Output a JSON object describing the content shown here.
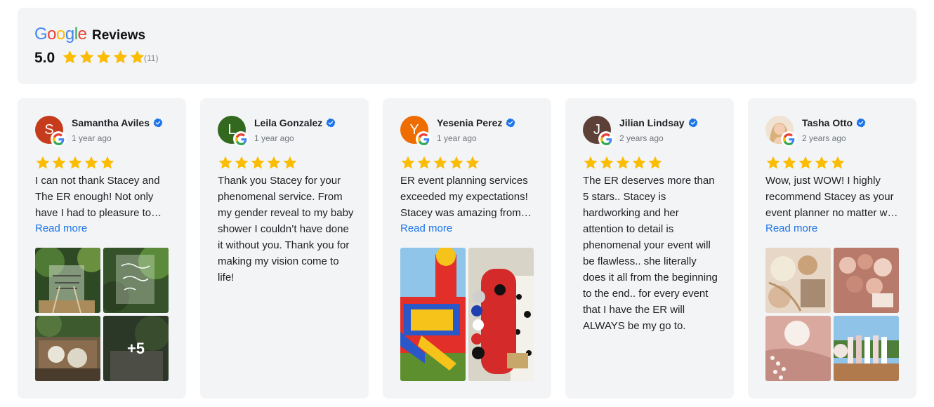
{
  "header": {
    "title": "Reviews",
    "rating": "5.0",
    "stars": 5,
    "count": "(11)",
    "logo_text": "Google"
  },
  "colors": {
    "star": "#fbbc04",
    "link": "#1a73e8",
    "verified": "#1a73e8",
    "card_bg": "#f3f4f6"
  },
  "reviews": [
    {
      "name": "Samantha Aviles",
      "initial": "S",
      "avatar_color": "#c53b1b",
      "date": "1 year ago",
      "stars": 5,
      "text": "I can not thank Stacey and The ER enough! Not only have I had to pleasure to work with her on many events...",
      "read_more": "Read more",
      "photo_more": "+5"
    },
    {
      "name": "Leila Gonzalez",
      "initial": "L",
      "avatar_color": "#33691e",
      "date": "1 year ago",
      "stars": 5,
      "text": "Thank you Stacey for your phenomenal service. From my gender reveal to my baby shower I couldn’t have done it without you. Thank you for making my vision come to life!"
    },
    {
      "name": "Yesenia Perez",
      "initial": "Y",
      "avatar_color": "#ef6c00",
      "date": "1 year ago",
      "stars": 5,
      "text": "ER event planning services exceeded my expectations! Stacey was amazing from start to finish...",
      "read_more": "Read more"
    },
    {
      "name": "Jilian Lindsay",
      "initial": "J",
      "avatar_color": "#5d4037",
      "date": "2 years ago",
      "stars": 5,
      "text": "The ER deserves more than 5 stars.. Stacey is hardworking and her attention to detail is phenomenal your event will be flawless.. she literally does it all from the beginning to the end.. for every event that I have the ER will ALWAYS be my go to."
    },
    {
      "name": "Tasha Otto",
      "initial": "",
      "avatar_color": "#e7c9a9",
      "date": "2 years ago",
      "stars": 5,
      "text": "Wow, just WOW! I highly recommend Stacey as your event planner no matter what the occasion...",
      "read_more": "Read more"
    }
  ]
}
